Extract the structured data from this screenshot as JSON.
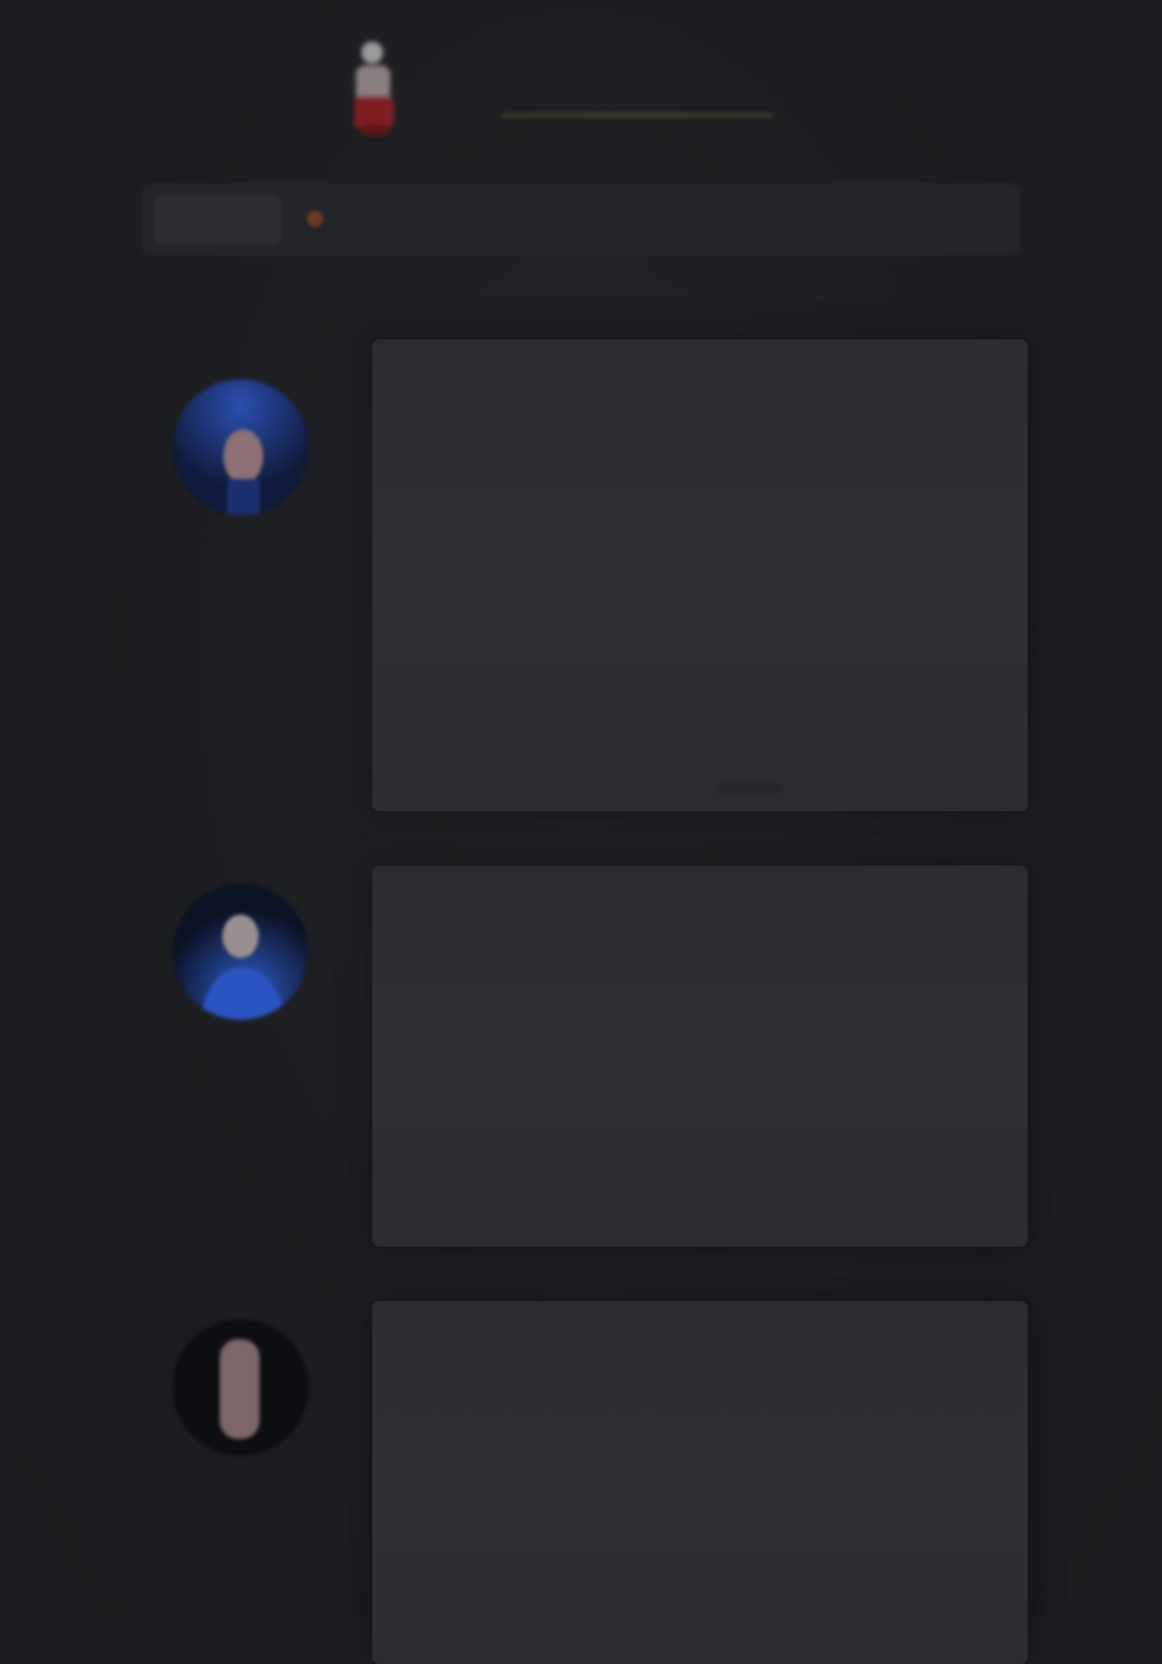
{
  "header": {
    "logo_text_part1": "",
    "logo_text_part2": "",
    "tagline": ""
  },
  "nav": {
    "left_label": ""
  },
  "cards": [
    {
      "title": "",
      "subtitle": "",
      "body": ""
    },
    {
      "title": "",
      "subtitle": "",
      "body": ""
    },
    {
      "title": "",
      "subtitle": "",
      "body": ""
    }
  ],
  "colors": {
    "background": "#1c1d20",
    "card": "#2c2e32",
    "accent_red": "#a3212b",
    "avatar_blue": "#1e3f8f"
  },
  "icons": {
    "logo": "figure-logo-icon",
    "avatar_1": "person-avatar-icon",
    "avatar_2": "person-avatar-icon",
    "avatar_3": "person-avatar-icon"
  }
}
